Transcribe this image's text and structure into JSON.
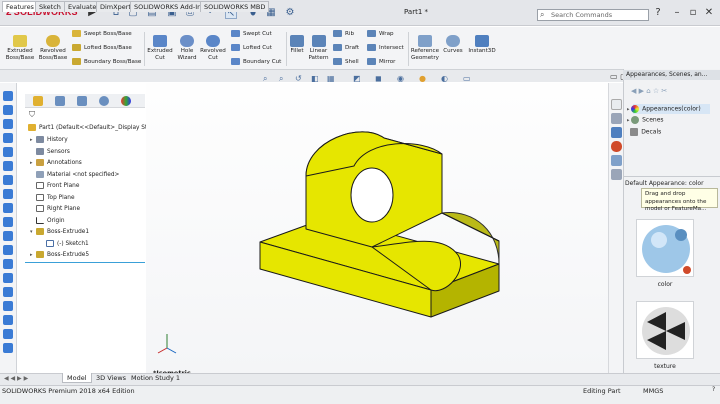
{
  "app": {
    "logo_text": "SOLIDWORKS",
    "document_title": "Part1 *",
    "search_placeholder": "Search Commands"
  },
  "command_manager": {
    "extruded_boss": "Extruded Boss/Base",
    "revolved_boss": "Revolved Boss/Base",
    "swept_boss": "Swept Boss/Base",
    "lofted_boss": "Lofted Boss/Base",
    "boundary_boss": "Boundary Boss/Base",
    "extruded_cut": "Extruded Cut",
    "hole_wizard": "Hole Wizard",
    "revolved_cut": "Revolved Cut",
    "swept_cut": "Swept Cut",
    "lofted_cut": "Lofted Cut",
    "boundary_cut": "Boundary Cut",
    "fillet": "Fillet",
    "linear_pattern": "Linear Pattern",
    "rib": "Rib",
    "draft": "Draft",
    "shell": "Shell",
    "wrap": "Wrap",
    "intersect": "Intersect",
    "mirror": "Mirror",
    "reference_geometry": "Reference Geometry",
    "curves": "Curves",
    "instant3d": "Instant3D"
  },
  "tabs": [
    "Features",
    "Sketch",
    "Evaluate",
    "DimXpert",
    "SOLIDWORKS Add-Ins",
    "SOLIDWORKS MBD"
  ],
  "feature_tree": {
    "root": "Part1  (Default<<Default>_Display Sta",
    "items": [
      {
        "label": "History"
      },
      {
        "label": "Sensors"
      },
      {
        "label": "Annotations"
      },
      {
        "label": "Material <not specified>"
      },
      {
        "label": "Front Plane"
      },
      {
        "label": "Top Plane"
      },
      {
        "label": "Right Plane"
      },
      {
        "label": "Origin"
      },
      {
        "label": "Boss-Extrude1"
      },
      {
        "label": "(-) Sketch1"
      },
      {
        "label": "Boss-Extrude5"
      }
    ]
  },
  "viewport": {
    "view_label": "*Isometric",
    "model_color": "#e6e600",
    "model_shadow_color": "#b4b400"
  },
  "task_pane": {
    "header": "Appearances, Scenes, an...",
    "items": [
      "Appearances(color)",
      "Scenes",
      "Decals"
    ],
    "sub_label": "Default Appearance: color",
    "tooltip": "Drag and drop appearances onto the model or FeatureMa...",
    "swatch1_label": "color",
    "swatch2_label": "texture"
  },
  "bottom_tabs": [
    "Model",
    "3D Views",
    "Motion Study 1"
  ],
  "status": {
    "edition": "SOLIDWORKS Premium 2018 x64 Edition",
    "mode": "Editing Part",
    "units": "MMGS"
  }
}
